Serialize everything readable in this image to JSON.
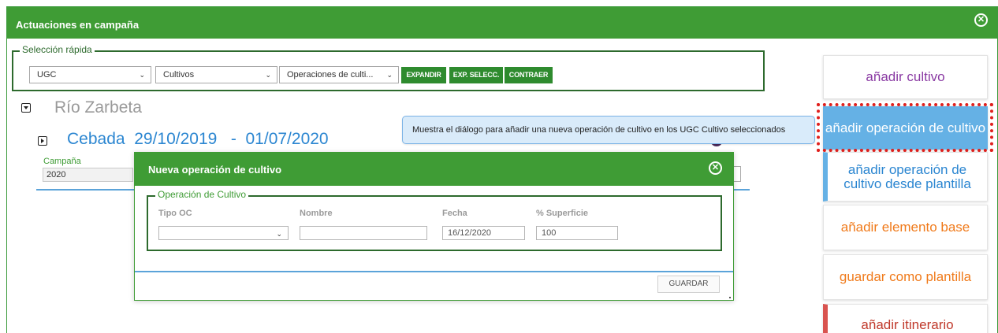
{
  "window": {
    "title": "Actuaciones en campaña",
    "close_icon": "⊗"
  },
  "quick_selection": {
    "legend": "Selección rápida",
    "selects": [
      {
        "value": "UGC"
      },
      {
        "value": "Cultivos"
      },
      {
        "value": "Operaciones de culti..."
      }
    ],
    "buttons": [
      "EXPANDIR",
      "EXP. SELECC.",
      "CONTRAER"
    ]
  },
  "tree": {
    "ugc_name": "Río Zarbeta",
    "crop_line": "Cebada  29/10/2019   -  01/07/2020",
    "campaign_label": "Campaña",
    "campaign_value": "2020"
  },
  "tooltip": {
    "text": "Muestra el diálogo para añadir una nueva operación de cultivo en los UGC Cultivo seleccionados"
  },
  "actions": [
    {
      "label": "añadir cultivo",
      "color": "#8a3aa3"
    },
    {
      "label": "añadir operación de cultivo",
      "color": "#ffffff"
    },
    {
      "label": "añadir operación de cultivo desde plantilla",
      "color": "#2b86d1"
    },
    {
      "label": "añadir elemento base",
      "color": "#f07b1c"
    },
    {
      "label": "guardar como plantilla",
      "color": "#f07b1c"
    },
    {
      "label": "añadir itinerario",
      "color": "#c0392b"
    }
  ],
  "modal": {
    "title": "Nueva operación de cultivo",
    "close_icon": "⊗",
    "legend": "Operación de Cultivo",
    "fields": {
      "tipo_label": "Tipo OC",
      "tipo_value": "",
      "nombre_label": "Nombre",
      "nombre_value": "",
      "fecha_label": "Fecha",
      "fecha_value": "16/12/2020",
      "superficie_label": "% Superficie",
      "superficie_value": "100"
    },
    "save_label": "GUARDAR"
  },
  "colors": {
    "header_green": "#3f9c35",
    "button_green": "#2e8b2e",
    "accent_blue": "#2b86d1",
    "highlight_red": "#e0201d"
  }
}
